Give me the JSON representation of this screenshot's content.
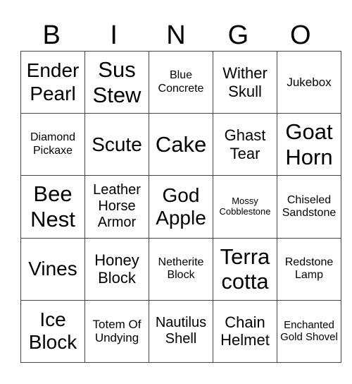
{
  "header": [
    "B",
    "I",
    "N",
    "G",
    "O"
  ],
  "rows": [
    [
      "Ender Pearl",
      "Sus Stew",
      "Blue Concrete",
      "Wither Skull",
      "Jukebox"
    ],
    [
      "Diamond Pickaxe",
      "Scute",
      "Cake",
      "Ghast Tear",
      "Goat Horn"
    ],
    [
      "Bee Nest",
      "Leather Horse Armor",
      "God Apple",
      "Mossy Cobblestone",
      "Chiseled Sandstone"
    ],
    [
      "Vines",
      "Honey Block",
      "Netherite Block",
      "Terra cotta",
      "Redstone Lamp"
    ],
    [
      "Ice Block",
      "Totem Of Undying",
      "Nautilus Shell",
      "Chain Helmet",
      "Enchanted Gold Shovel"
    ]
  ]
}
